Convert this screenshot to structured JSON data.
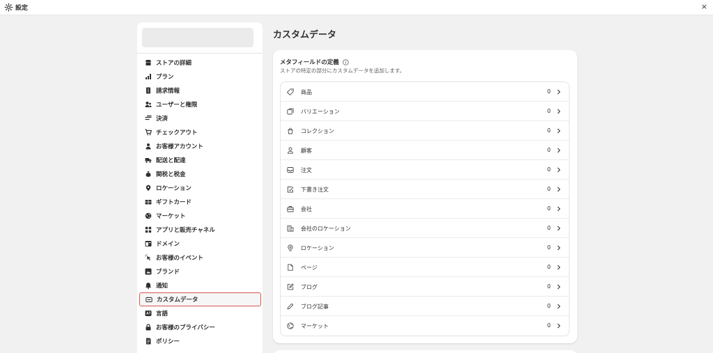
{
  "window": {
    "title": "設定",
    "close_label": "×"
  },
  "sidebar": {
    "items": [
      {
        "label": "ストアの詳細",
        "icon": "store-icon"
      },
      {
        "label": "プラン",
        "icon": "plan-icon"
      },
      {
        "label": "請求情報",
        "icon": "billing-icon"
      },
      {
        "label": "ユーザーと権限",
        "icon": "users-icon"
      },
      {
        "label": "決済",
        "icon": "payments-icon"
      },
      {
        "label": "チェックアウト",
        "icon": "cart-icon"
      },
      {
        "label": "お客様アカウント",
        "icon": "person-icon"
      },
      {
        "label": "配送と配達",
        "icon": "truck-icon"
      },
      {
        "label": "関税と税金",
        "icon": "money-bag-icon"
      },
      {
        "label": "ロケーション",
        "icon": "location-icon"
      },
      {
        "label": "ギフトカード",
        "icon": "gift-card-icon"
      },
      {
        "label": "マーケット",
        "icon": "globe-icon"
      },
      {
        "label": "アプリと販売チャネル",
        "icon": "apps-icon"
      },
      {
        "label": "ドメイン",
        "icon": "domain-icon"
      },
      {
        "label": "お客様のイベント",
        "icon": "cursor-icon"
      },
      {
        "label": "ブランド",
        "icon": "brand-icon"
      },
      {
        "label": "通知",
        "icon": "bell-icon"
      },
      {
        "label": "カスタムデータ",
        "icon": "custom-data-icon",
        "active": true
      },
      {
        "label": "言語",
        "icon": "language-icon"
      },
      {
        "label": "お客様のプライバシー",
        "icon": "lock-icon"
      },
      {
        "label": "ポリシー",
        "icon": "policy-icon"
      }
    ]
  },
  "main": {
    "title": "カスタムデータ",
    "card": {
      "heading": "メタフィールドの定義",
      "subtitle": "ストアの特定の部分にカスタムデータを追加します。",
      "rows": [
        {
          "label": "商品",
          "count": "0",
          "icon": "tag-icon"
        },
        {
          "label": "バリエーション",
          "count": "0",
          "icon": "variants-icon"
        },
        {
          "label": "コレクション",
          "count": "0",
          "icon": "collection-icon"
        },
        {
          "label": "顧客",
          "count": "0",
          "icon": "person-outline-icon"
        },
        {
          "label": "注文",
          "count": "0",
          "icon": "inbox-icon"
        },
        {
          "label": "下書き注文",
          "count": "0",
          "icon": "draft-order-icon"
        },
        {
          "label": "会社",
          "count": "0",
          "icon": "company-icon"
        },
        {
          "label": "会社のロケーション",
          "count": "0",
          "icon": "company-location-icon"
        },
        {
          "label": "ロケーション",
          "count": "0",
          "icon": "location-outline-icon"
        },
        {
          "label": "ページ",
          "count": "0",
          "icon": "page-icon"
        },
        {
          "label": "ブログ",
          "count": "0",
          "icon": "blog-icon"
        },
        {
          "label": "ブログ記事",
          "count": "0",
          "icon": "pen-icon"
        },
        {
          "label": "マーケット",
          "count": "0",
          "icon": "globe-outline-icon"
        }
      ]
    }
  },
  "colors": {
    "highlight_border": "#d9534f",
    "background": "#f1f1f1"
  }
}
